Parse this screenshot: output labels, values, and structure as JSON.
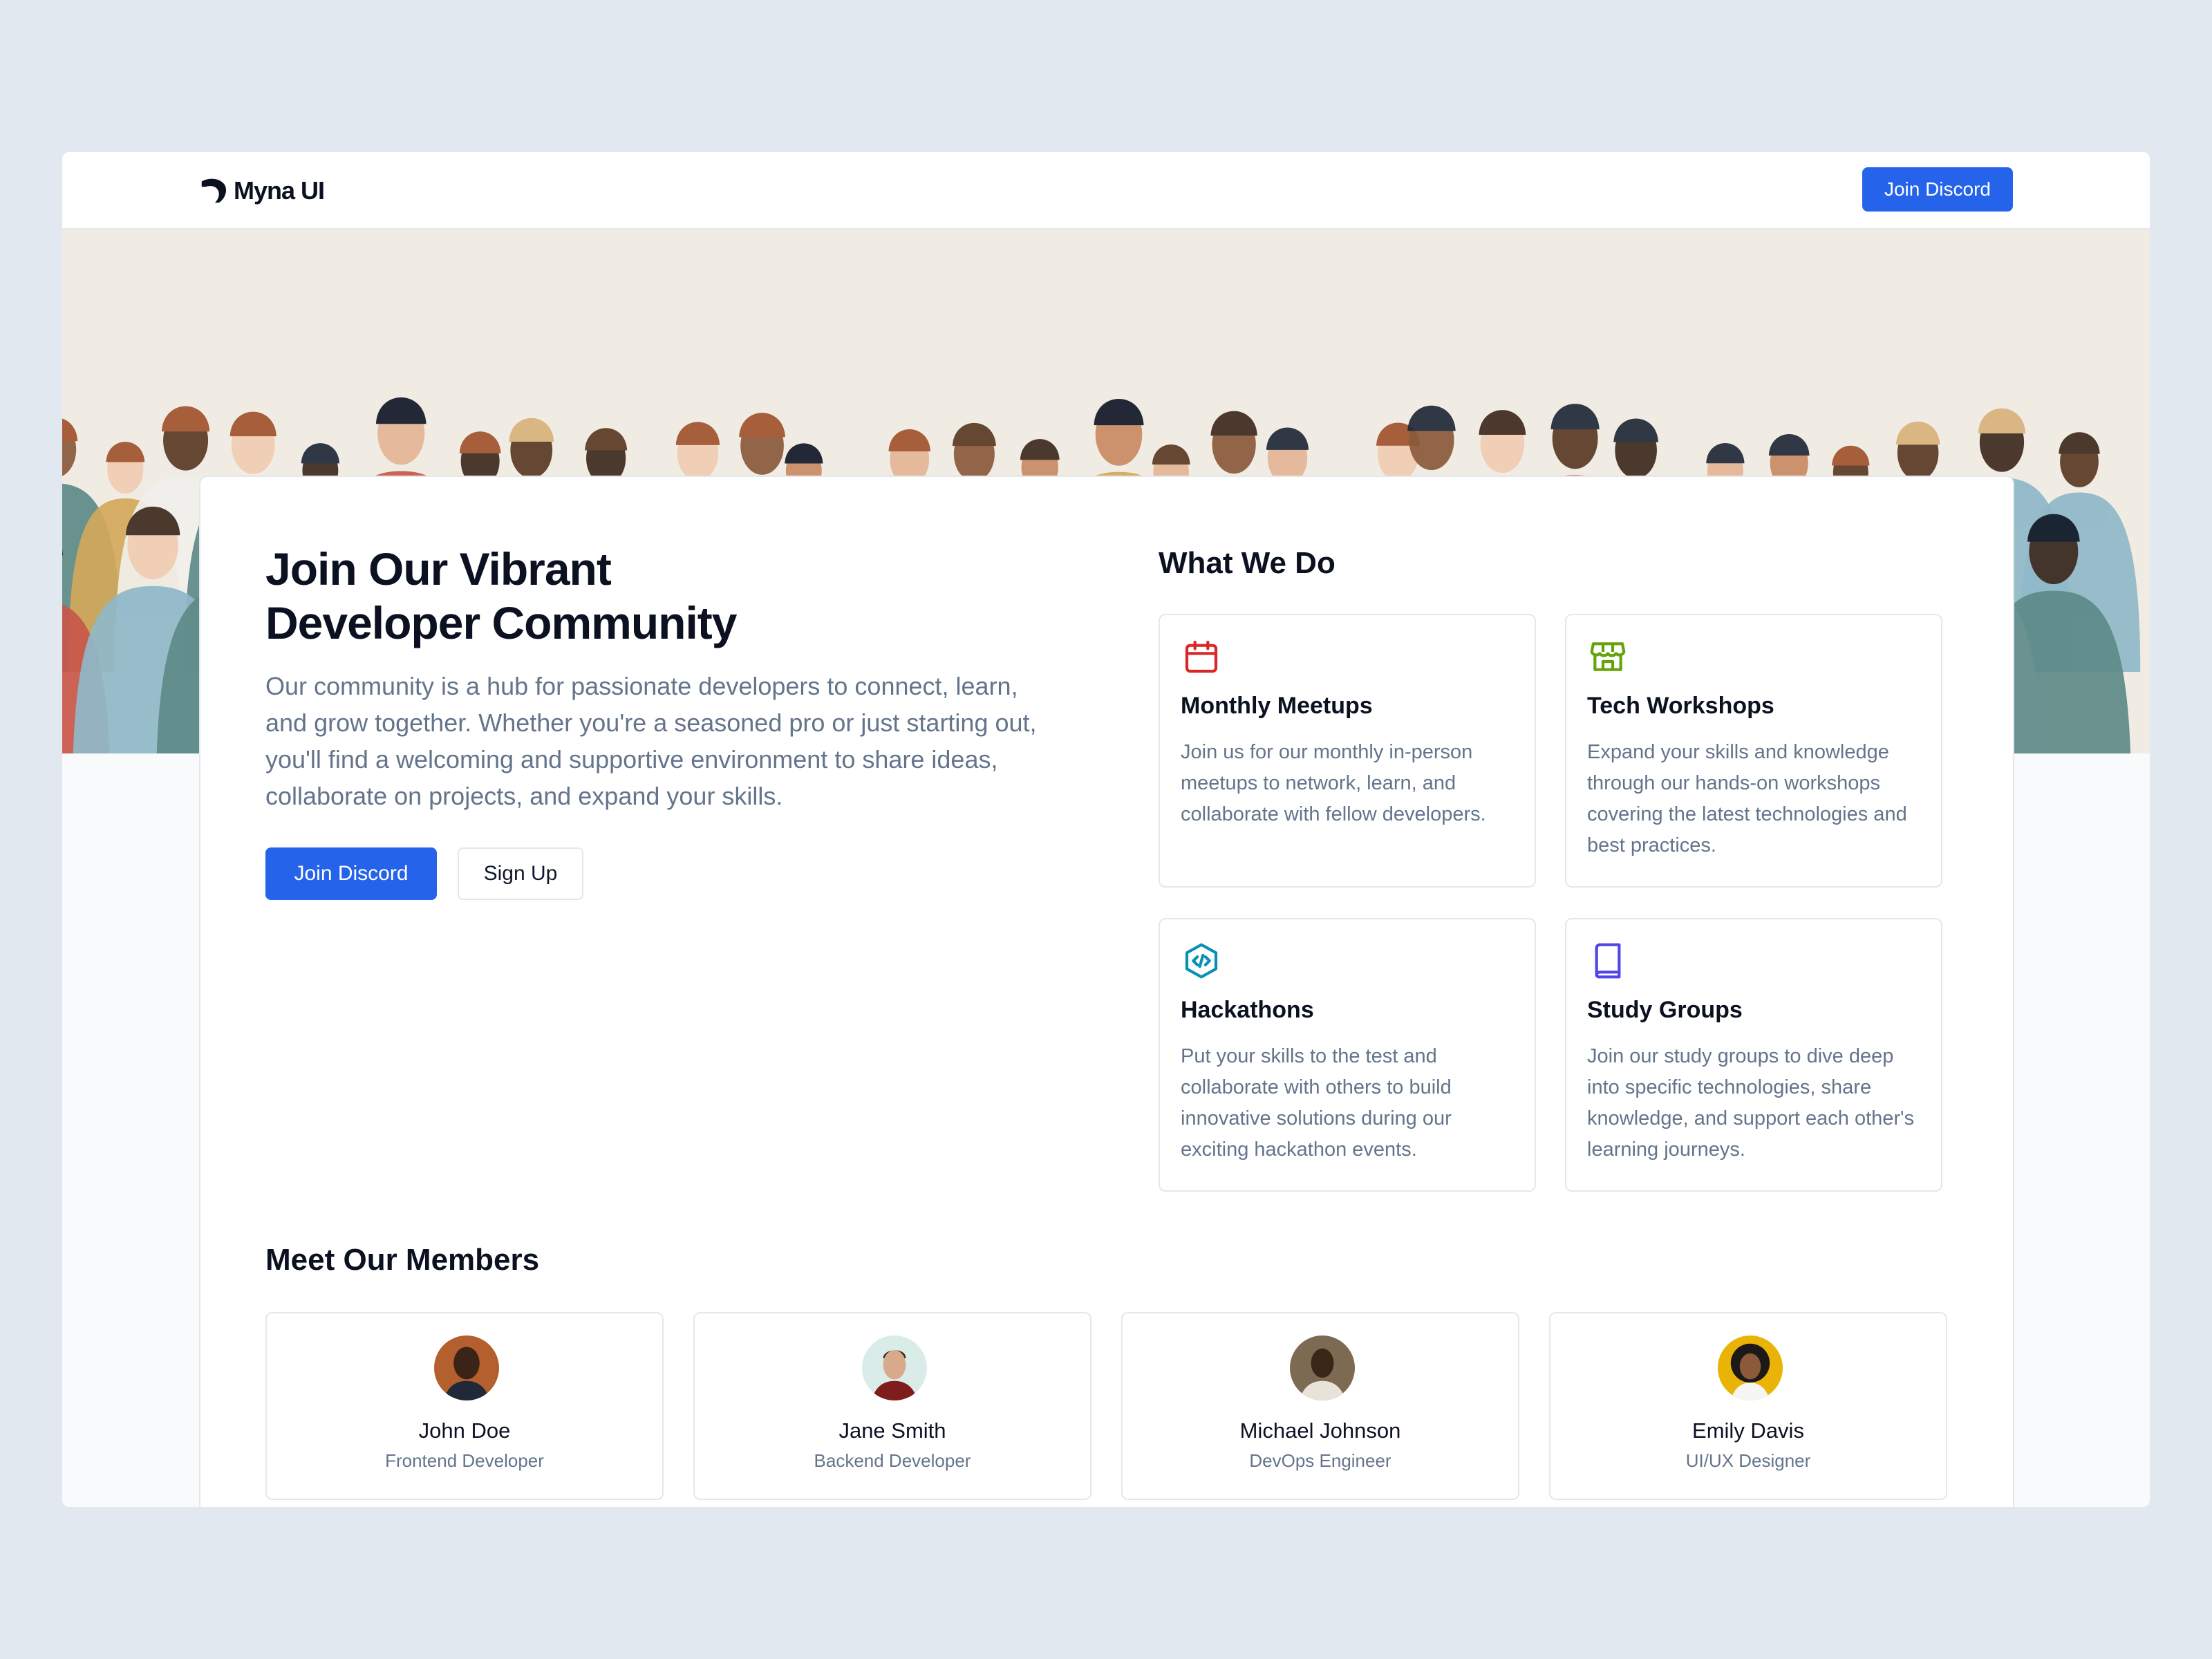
{
  "nav": {
    "brand": "Myna UI",
    "cta_label": "Join Discord"
  },
  "hero": {
    "title_line1": "Join Our Vibrant",
    "title_line2": "Developer Community",
    "description": "Our community is a hub for passionate developers to connect, learn, and grow together. Whether you're a seasoned pro or just starting out, you'll find a welcoming and supportive environment to share ideas, collaborate on projects, and expand your skills.",
    "primary_label": "Join Discord",
    "secondary_label": "Sign Up"
  },
  "what_we_do": {
    "title": "What We Do",
    "items": [
      {
        "icon": "calendar-icon",
        "color": "#dc2626",
        "title": "Monthly Meetups",
        "description": "Join us for our monthly in-person meetups to network, learn, and collaborate with fellow developers."
      },
      {
        "icon": "store-icon",
        "color": "#65a30d",
        "title": "Tech Workshops",
        "description": "Expand your skills and knowledge through our hands-on workshops covering the latest technologies and best practices."
      },
      {
        "icon": "code-hexagon-icon",
        "color": "#0891b2",
        "title": "Hackathons",
        "description": "Put your skills to the test and collaborate with others to build innovative solutions during our exciting hackathon events."
      },
      {
        "icon": "book-icon",
        "color": "#4f46e5",
        "title": "Study Groups",
        "description": "Join our study groups to dive deep into specific technologies, share knowledge, and support each other's learning journeys."
      }
    ]
  },
  "members": {
    "title": "Meet Our Members",
    "items": [
      {
        "name": "John Doe",
        "role": "Frontend Developer"
      },
      {
        "name": "Jane Smith",
        "role": "Backend Developer"
      },
      {
        "name": "Michael Johnson",
        "role": "DevOps Engineer"
      },
      {
        "name": "Emily Davis",
        "role": "UI/UX Designer"
      }
    ]
  },
  "colors": {
    "accent": "#2563eb",
    "text": "#0b1120",
    "muted": "#64748b",
    "border": "#e5e7eb",
    "page": "#e2e8f0"
  }
}
